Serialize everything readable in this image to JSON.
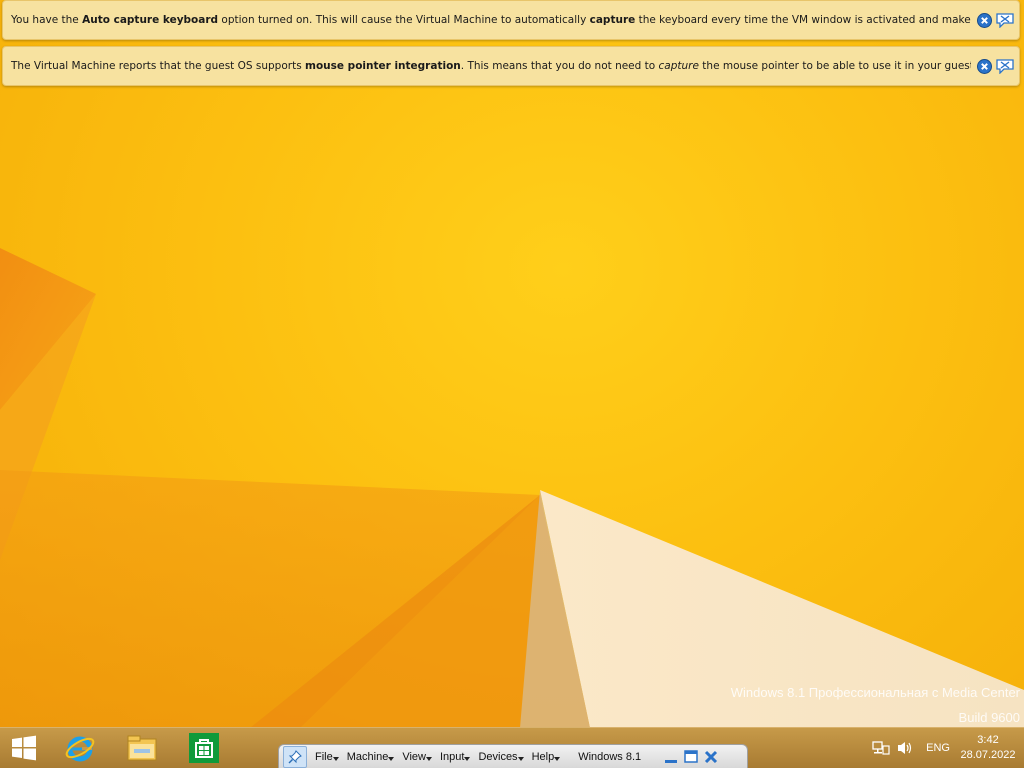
{
  "notifications": [
    {
      "segments": [
        {
          "text": "You have the ",
          "bold": false,
          "italic": false
        },
        {
          "text": "Auto capture keyboard",
          "bold": true,
          "italic": false
        },
        {
          "text": " option turned on. This will cause the Virtual Machine to automatically ",
          "bold": false,
          "italic": false
        },
        {
          "text": "capture",
          "bold": true,
          "italic": false
        },
        {
          "text": " the keyboard every time the VM window is activated and make it unavailable to",
          "bold": false,
          "italic": false
        }
      ]
    },
    {
      "segments": [
        {
          "text": "The Virtual Machine reports that the guest OS supports ",
          "bold": false,
          "italic": false
        },
        {
          "text": "mouse pointer integration",
          "bold": true,
          "italic": false
        },
        {
          "text": ". This means that you do not need to ",
          "bold": false,
          "italic": false
        },
        {
          "text": "capture",
          "bold": false,
          "italic": true
        },
        {
          "text": " the mouse pointer to be able to use it in your guest OS -- all mouse",
          "bold": false,
          "italic": false
        }
      ]
    }
  ],
  "watermark": {
    "line1": "Windows 8.1 Профессиональная с Media Center",
    "line2": "Build 9600"
  },
  "taskbar": {
    "apps": [
      {
        "name": "start-icon"
      },
      {
        "name": "internet-explorer-icon"
      },
      {
        "name": "file-explorer-icon"
      },
      {
        "name": "store-icon"
      }
    ]
  },
  "mini_toolbar": {
    "menus": [
      "File",
      "Machine",
      "View",
      "Input",
      "Devices",
      "Help"
    ],
    "vm_name": "Windows 8.1"
  },
  "tray": {
    "language": "ENG",
    "time": "3:42",
    "date": "28.07.2022"
  },
  "colors": {
    "wallpaper": "#fcbf10",
    "notification_bg": "#f7e2a0",
    "taskbar": "#b88a3d"
  }
}
